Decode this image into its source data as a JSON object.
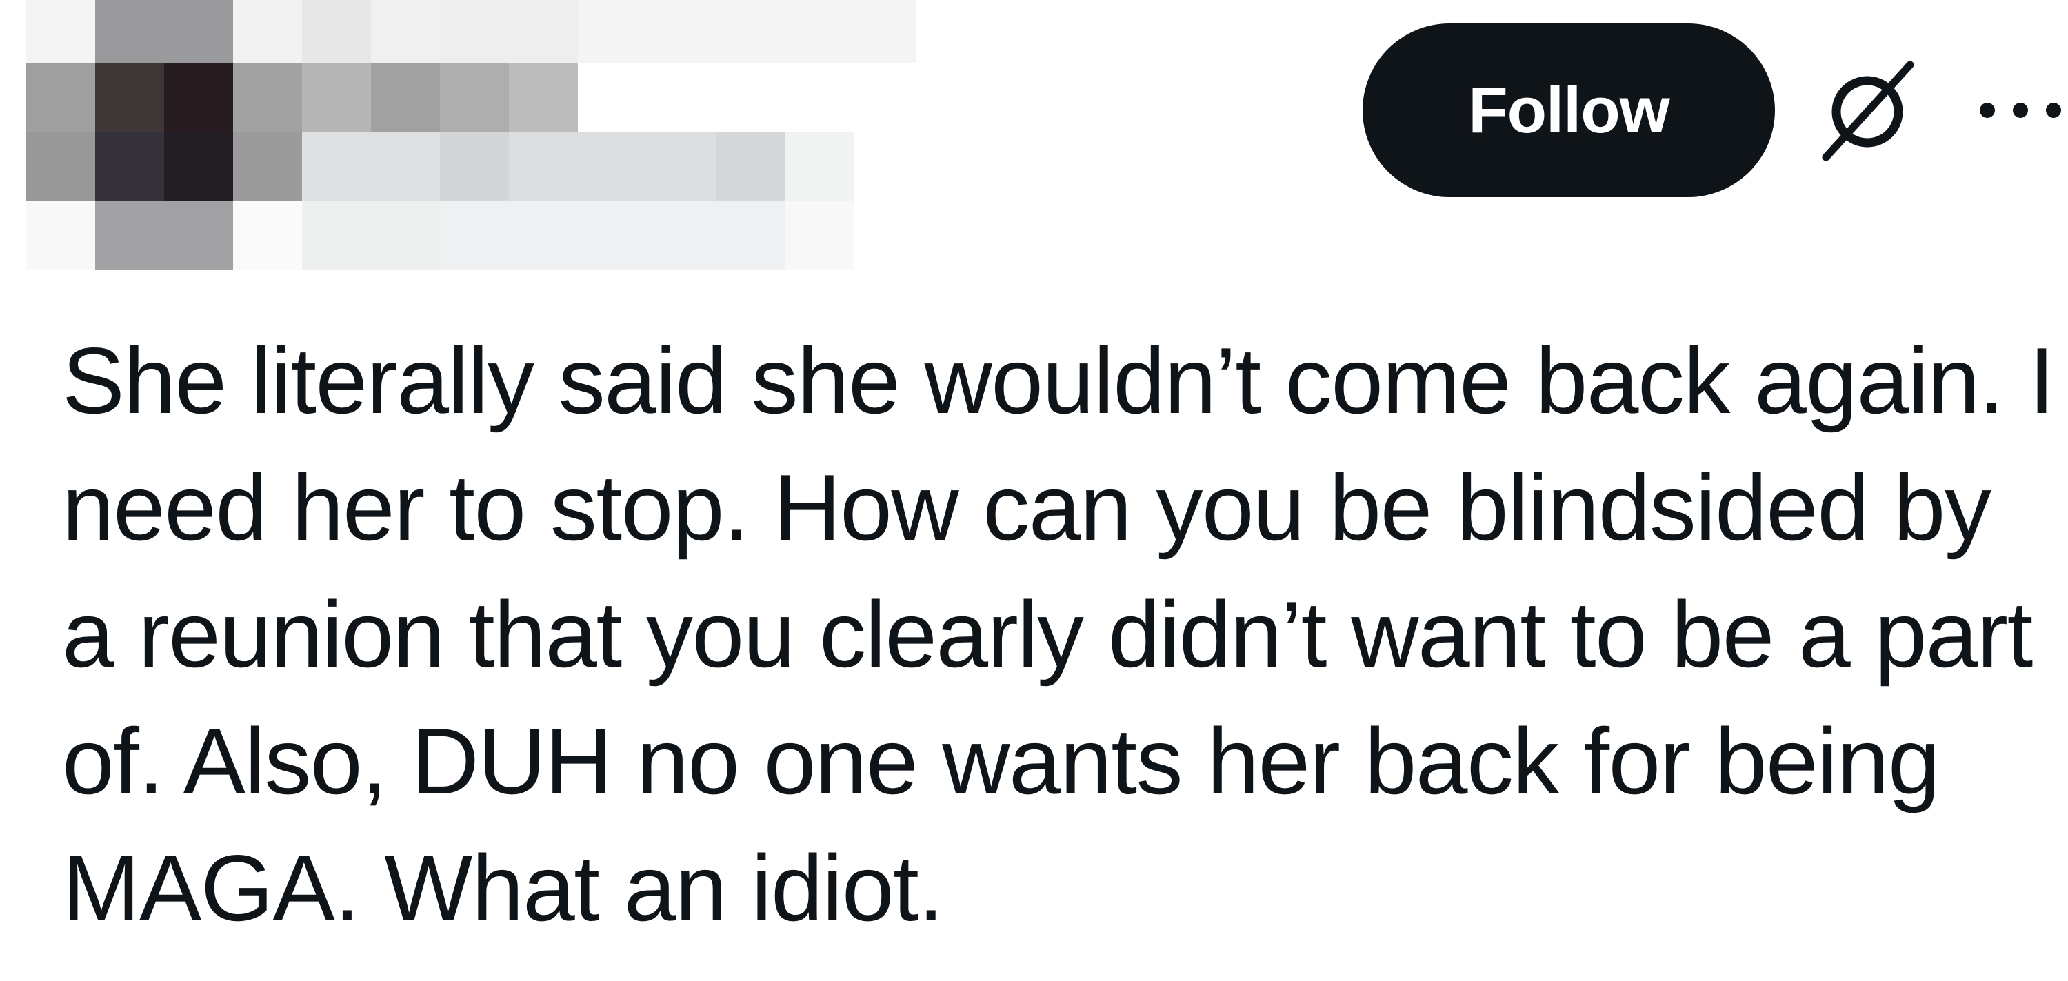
{
  "profile": {
    "name": "",
    "handle": ""
  },
  "actions": {
    "follow_label": "Follow",
    "grok_icon": "grok-slash-icon",
    "more_icon": "more-horizontal-icon"
  },
  "tweet": {
    "text": "She literally said she wouldn’t come back again. I need her to stop. How can you be blindsided by a reunion that you clearly didn’t want to be a part of. Also, DUH no one wants her back for being MAGA. What an idiot."
  },
  "colors": {
    "text": "#0f1419",
    "follow_bg": "#0f1419",
    "follow_text": "#ffffff",
    "background": "#ffffff"
  }
}
